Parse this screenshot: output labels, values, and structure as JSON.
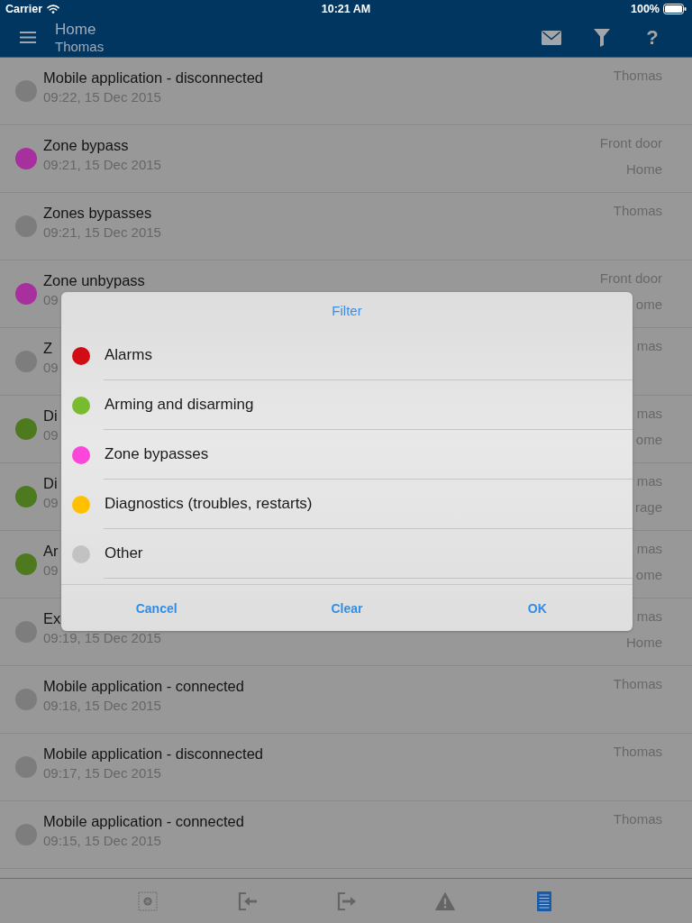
{
  "status_bar": {
    "carrier": "Carrier",
    "time": "10:21 AM",
    "battery": "100%"
  },
  "header": {
    "title": "Home",
    "subtitle": "Thomas",
    "help": "?"
  },
  "events": [
    {
      "title": "Mobile application - disconnected",
      "time": "09:22, 15 Dec 2015",
      "details": [
        "Thomas"
      ],
      "color": "#7d7d7d"
    },
    {
      "title": "Zone bypass",
      "time": "09:21, 15 Dec 2015",
      "details": [
        "Front door",
        "Home"
      ],
      "color": "#a8309e"
    },
    {
      "title": "Zones bypasses",
      "time": "09:21, 15 Dec 2015",
      "details": [
        "Thomas"
      ],
      "color": "#7d7d7d"
    },
    {
      "title": "Zone unbypass",
      "time": "09",
      "details": [
        "Front door",
        "ome"
      ],
      "color": "#a8309e"
    },
    {
      "title": "Z",
      "time": "09",
      "details": [
        "mas"
      ],
      "color": "#7d7d7d"
    },
    {
      "title": "Di",
      "time": "09",
      "details": [
        "mas",
        "ome"
      ],
      "color": "#4d7a1f"
    },
    {
      "title": "Di",
      "time": "09",
      "details": [
        "mas",
        "rage"
      ],
      "color": "#4d7a1f"
    },
    {
      "title": "Ar",
      "time": "09",
      "details": [
        "mas",
        "ome"
      ],
      "color": "#4d7a1f"
    },
    {
      "title": "Ex",
      "time": "09:19, 15 Dec 2015",
      "details": [
        "mas",
        "Home"
      ],
      "color": "#7d7d7d"
    },
    {
      "title": "Mobile application - connected",
      "time": "09:18, 15 Dec 2015",
      "details": [
        "Thomas"
      ],
      "color": "#7d7d7d"
    },
    {
      "title": "Mobile application - disconnected",
      "time": "09:17, 15 Dec 2015",
      "details": [
        "Thomas"
      ],
      "color": "#7d7d7d"
    },
    {
      "title": "Mobile application - connected",
      "time": "09:15, 15 Dec 2015",
      "details": [
        "Thomas"
      ],
      "color": "#7d7d7d"
    }
  ],
  "filter_dialog": {
    "title": "Filter",
    "options": [
      {
        "label": "Alarms",
        "color": "#d20c14"
      },
      {
        "label": "Arming and disarming",
        "color": "#78bb2f"
      },
      {
        "label": "Zone bypasses",
        "color": "#fb46d9"
      },
      {
        "label": "Diagnostics (troubles, restarts)",
        "color": "#ffc000"
      },
      {
        "label": "Other",
        "color": "#c2c2c2"
      }
    ],
    "buttons": [
      "Cancel",
      "Clear",
      "OK"
    ]
  },
  "tab_bar": {
    "tabs": [
      {
        "kind": "zones",
        "selected": false
      },
      {
        "kind": "enter",
        "selected": false
      },
      {
        "kind": "exit",
        "selected": false
      },
      {
        "kind": "warning",
        "selected": false
      },
      {
        "kind": "list",
        "selected": true
      }
    ]
  }
}
